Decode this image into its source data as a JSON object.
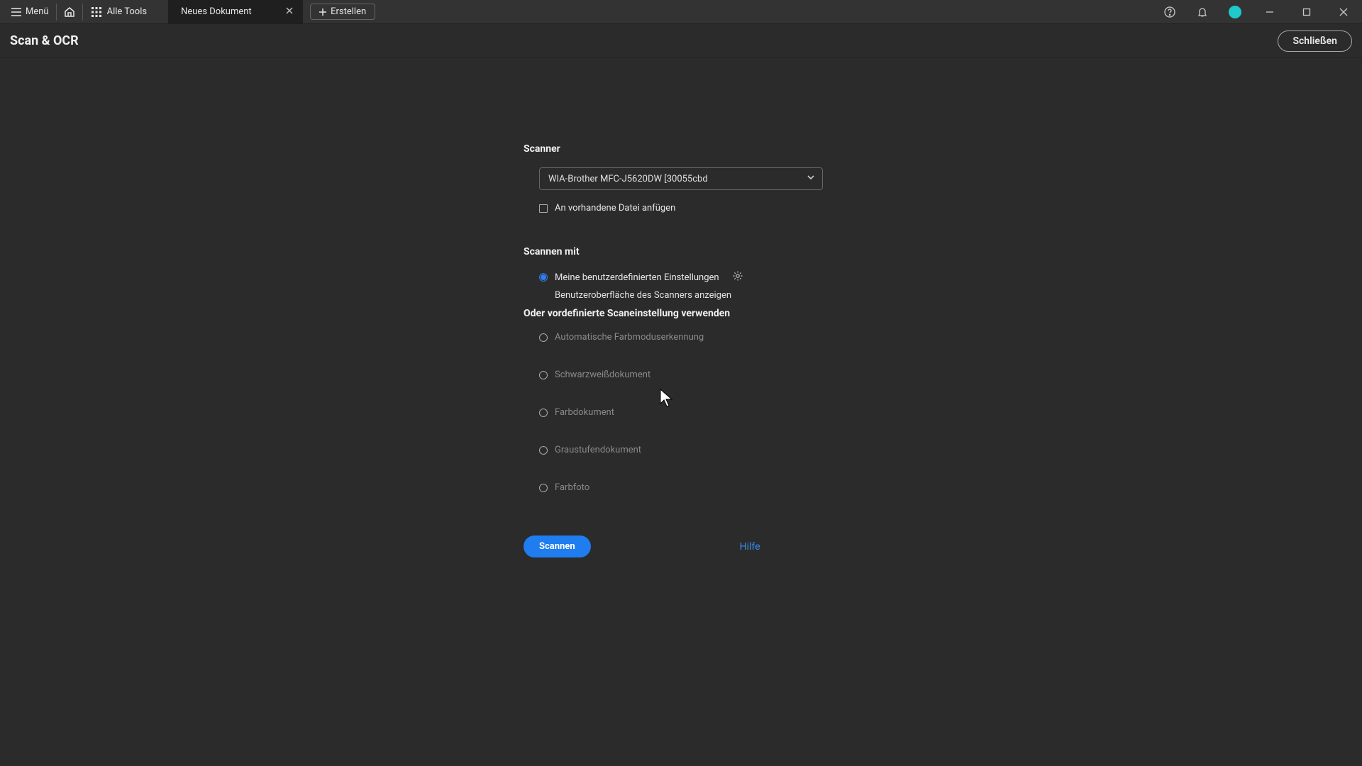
{
  "titlebar": {
    "menu_label": "Menü",
    "all_tools_label": "Alle Tools",
    "tab_title": "Neues Dokument",
    "create_label": "Erstellen"
  },
  "toolbar": {
    "page_title": "Scan & OCR",
    "close_label": "Schließen"
  },
  "form": {
    "scanner_section_label": "Scanner",
    "scanner_selected": "WIA-Brother MFC-J5620DW [30055cbd",
    "append_checkbox_label": "An vorhandene Datei anfügen",
    "scan_with_section_label": "Scannen mit",
    "radio_custom_label": "Meine benutzerdefinierten Einstellungen",
    "custom_subtext": "Benutzeroberfläche des Scanners anzeigen",
    "preset_header": "Oder vordefinierte Scaneinstellung verwenden",
    "presets": {
      "auto_color": "Automatische Farbmoduserkennung",
      "bw_doc": "Schwarzweißdokument",
      "color_doc": "Farbdokument",
      "gray_doc": "Graustufendokument",
      "color_photo": "Farbfoto"
    },
    "scan_button": "Scannen",
    "help_link": "Hilfe"
  },
  "colors": {
    "accent": "#1f7def",
    "avatar": "#1fc9c9"
  }
}
